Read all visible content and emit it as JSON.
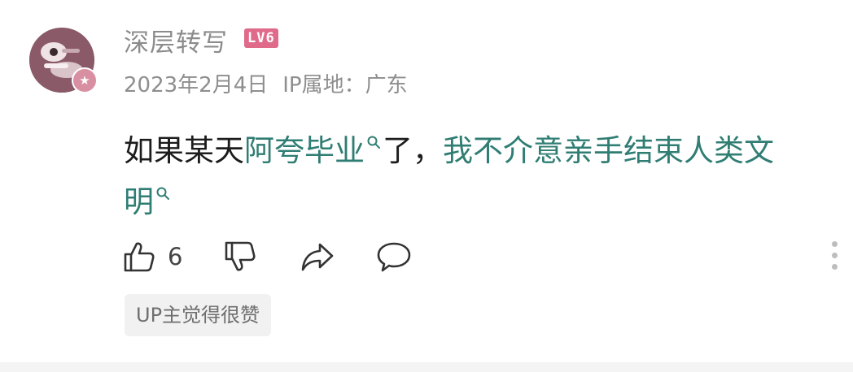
{
  "comment": {
    "username": "深层转写",
    "level": "LV6",
    "date": "2023年2月4日",
    "ip_location": "IP属地：广东",
    "content": {
      "t1": "如果某天",
      "kw1": "阿夸毕业",
      "t2": "了，",
      "kw2a": "我不介意亲手结束人类文",
      "kw2b": "明"
    },
    "like_count": "6",
    "up_tag": "UP主觉得很赞"
  },
  "icons": {
    "avatar_badge": "star-badge-icon",
    "search": "search-icon",
    "like": "thumbs-up-icon",
    "dislike": "thumbs-down-icon",
    "share": "share-arrow-icon",
    "reply": "speech-bubble-icon",
    "more": "vertical-dots-icon"
  },
  "colors": {
    "keyword": "#2f7d73",
    "level_badge": "#e06a8a",
    "meta_text": "#8e8e8e"
  }
}
